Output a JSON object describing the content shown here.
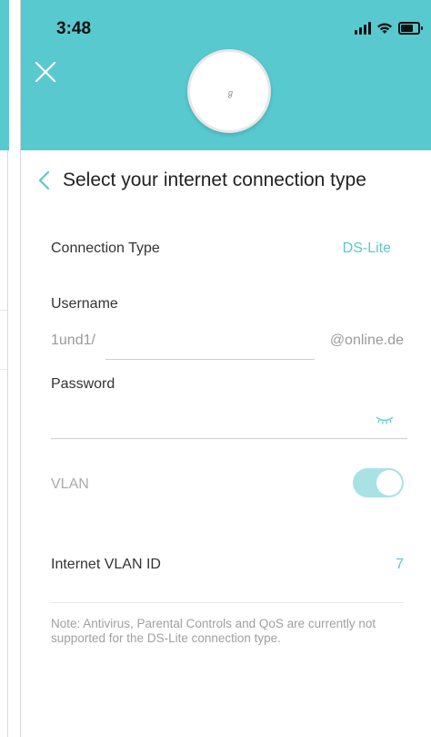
{
  "status": {
    "time": "3:48"
  },
  "page": {
    "title": "Select your internet connection type"
  },
  "connection": {
    "label": "Connection Type",
    "value": "DS-Lite"
  },
  "username": {
    "label": "Username",
    "prefix": "1und1/",
    "value": "",
    "suffix": "@online.de"
  },
  "password": {
    "label": "Password",
    "value": ""
  },
  "vlan": {
    "label": "VLAN",
    "enabled": true
  },
  "vlan_id": {
    "label": "Internet VLAN ID",
    "value": "7"
  },
  "note": "Note: Antivirus, Parental Controls and QoS are currently not supported for the DS-Lite connection type.",
  "colors": {
    "accent": "#58c9cf",
    "toggle_on": "#a8e2e5"
  },
  "icons": [
    "close-icon",
    "back-chevron-icon",
    "eye-closed-icon",
    "signal-icon",
    "wifi-icon",
    "battery-icon"
  ]
}
